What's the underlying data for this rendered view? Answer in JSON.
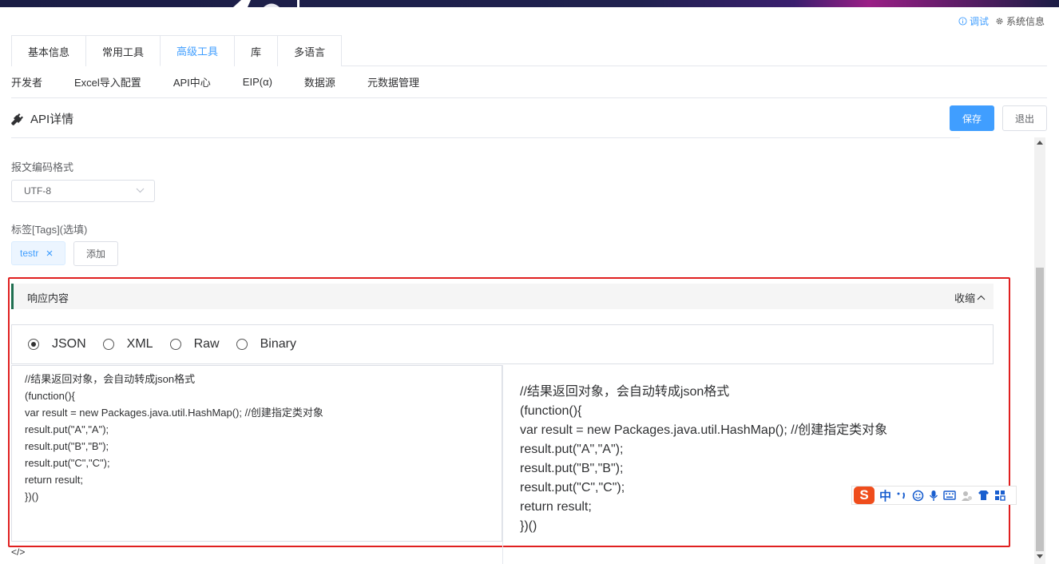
{
  "topbar": {
    "debug_label": "调试",
    "sysinfo_label": "系统信息"
  },
  "tabs_primary": [
    {
      "label": "基本信息",
      "active": false
    },
    {
      "label": "常用工具",
      "active": false
    },
    {
      "label": "高级工具",
      "active": true
    },
    {
      "label": "库",
      "active": false
    },
    {
      "label": "多语言",
      "active": false
    }
  ],
  "tabs_secondary": [
    {
      "label": "开发者"
    },
    {
      "label": "Excel导入配置"
    },
    {
      "label": "API中心"
    },
    {
      "label": "EIP(α)"
    },
    {
      "label": "数据源"
    },
    {
      "label": "元数据管理"
    }
  ],
  "header": {
    "title": "API详情",
    "save_label": "保存",
    "exit_label": "退出"
  },
  "form": {
    "encoding_label": "报文编码格式",
    "encoding_value": "UTF-8",
    "tags_label": "标签[Tags](选填)",
    "tag_value": "testr",
    "add_label": "添加"
  },
  "response": {
    "title": "响应内容",
    "collapse_label": "收缩",
    "formats": [
      {
        "label": "JSON",
        "selected": true
      },
      {
        "label": "XML",
        "selected": false
      },
      {
        "label": "Raw",
        "selected": false
      },
      {
        "label": "Binary",
        "selected": false
      }
    ],
    "code_lines": [
      "//结果返回对象，会自动转成json格式",
      "(function(){",
      "var result = new Packages.java.util.HashMap(); //创建指定类对象",
      "result.put(\"A\",\"A\");",
      "result.put(\"B\",\"B\");",
      "result.put(\"C\",\"C\");",
      "return result;",
      "})()"
    ],
    "code_icon": "</>"
  },
  "ime": {
    "logo": "S",
    "mode": "中"
  },
  "colors": {
    "primary": "#409eff",
    "highlight_box": "#e02020",
    "section_accent": "#1f6f50"
  }
}
